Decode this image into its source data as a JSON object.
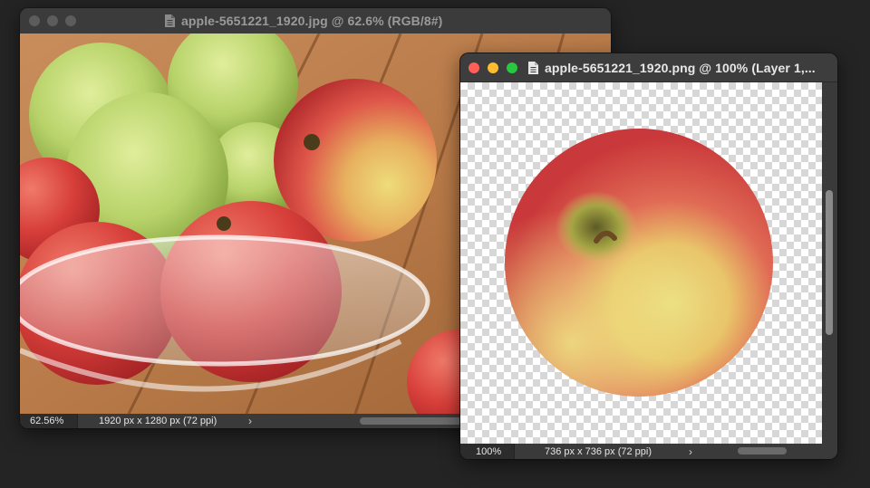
{
  "colors": {
    "close": "#ff5f57",
    "minimize": "#febc2e",
    "zoom": "#28c840",
    "inactive_dot": "#5c5c5c"
  },
  "window1": {
    "title": "apple-5651221_1920.jpg @ 62.6% (RGB/8#)",
    "doc_icon": "document-icon",
    "status": {
      "zoom": "62.56%",
      "info": "1920 px x 1280 px (72 ppi)",
      "chevron": "›"
    }
  },
  "window2": {
    "title": "apple-5651221_1920.png @ 100% (Layer 1,...",
    "doc_icon": "document-icon",
    "status": {
      "zoom": "100%",
      "info": "736 px x 736 px (72 ppi)",
      "chevron": "›"
    }
  }
}
